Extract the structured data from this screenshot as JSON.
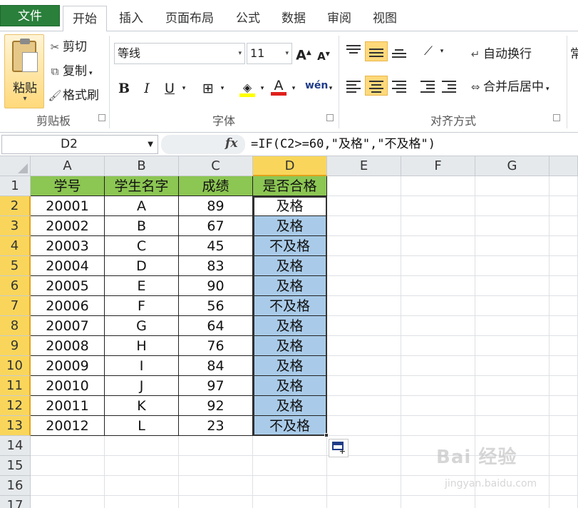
{
  "ribbon_tabs": {
    "file": "文件",
    "home": "开始",
    "insert": "插入",
    "page_layout": "页面布局",
    "formulas": "公式",
    "data": "数据",
    "review": "审阅",
    "view": "视图"
  },
  "clipboard": {
    "paste": "粘贴",
    "cut": "剪切",
    "copy": "复制",
    "format_painter": "格式刷",
    "group_label": "剪贴板"
  },
  "font": {
    "name": "等线",
    "size": "11",
    "grow": "A",
    "shrink": "A",
    "bold": "B",
    "italic": "I",
    "underline": "U",
    "font_color_letter": "A",
    "phonetic": "wén",
    "group_label": "字体"
  },
  "alignment": {
    "wrap_text": "自动换行",
    "merge_center": "合并后居中",
    "group_label": "对齐方式",
    "number_format_partial": "常"
  },
  "formula_bar": {
    "name_box": "D2",
    "fx": "fx",
    "formula": "=IF(C2>=60,\"及格\",\"不及格\")"
  },
  "columns": [
    "A",
    "B",
    "C",
    "D",
    "E",
    "F",
    "G"
  ],
  "rows": [
    "1",
    "2",
    "3",
    "4",
    "5",
    "6",
    "7",
    "8",
    "9",
    "10",
    "11",
    "12",
    "13",
    "14",
    "15",
    "16",
    "17"
  ],
  "table": {
    "headers": [
      "学号",
      "学生名字",
      "成绩",
      "是否合格"
    ],
    "rows": [
      [
        "20001",
        "A",
        "89",
        "及格"
      ],
      [
        "20002",
        "B",
        "67",
        "及格"
      ],
      [
        "20003",
        "C",
        "45",
        "不及格"
      ],
      [
        "20004",
        "D",
        "83",
        "及格"
      ],
      [
        "20005",
        "E",
        "90",
        "及格"
      ],
      [
        "20006",
        "F",
        "56",
        "不及格"
      ],
      [
        "20007",
        "G",
        "64",
        "及格"
      ],
      [
        "20008",
        "H",
        "76",
        "及格"
      ],
      [
        "20009",
        "I",
        "84",
        "及格"
      ],
      [
        "20010",
        "J",
        "97",
        "及格"
      ],
      [
        "20011",
        "K",
        "92",
        "及格"
      ],
      [
        "20012",
        "L",
        "23",
        "不及格"
      ]
    ]
  },
  "watermark": {
    "brand": "Bai 经验",
    "url": "jingyan.baidu.com"
  },
  "colors": {
    "header_fill": "#8cc653",
    "selection_fill": "#a9cbe9",
    "selected_heading": "#f9d65b",
    "file_tab": "#2a7f3b"
  }
}
